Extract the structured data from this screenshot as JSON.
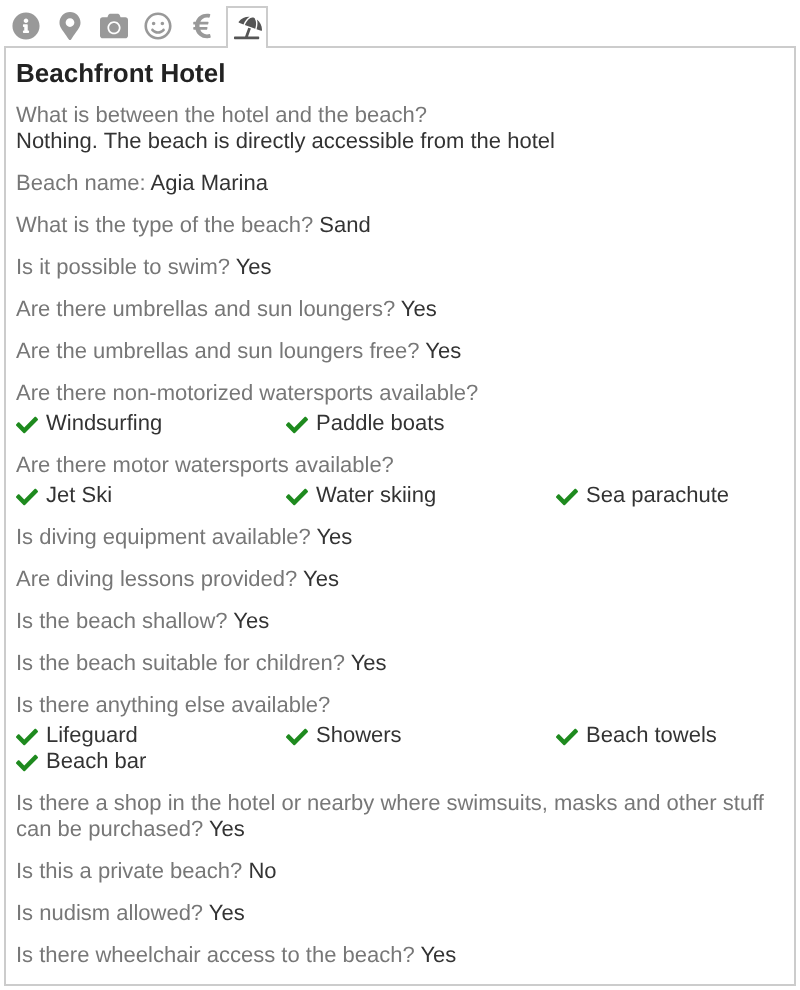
{
  "tabs": [
    {
      "selected": false
    },
    {
      "selected": false
    },
    {
      "selected": false
    },
    {
      "selected": false
    },
    {
      "selected": false
    },
    {
      "selected": true
    }
  ],
  "panel": {
    "title": "Beachfront Hotel",
    "items": [
      {
        "kind": "block",
        "question": "What is between the hotel and the beach?",
        "answer": "Nothing. The beach is directly accessible from the hotel"
      },
      {
        "kind": "inline",
        "question": "Beach name:",
        "answer": "Agia Marina"
      },
      {
        "kind": "inline",
        "question": "What is the type of the beach?",
        "answer": "Sand"
      },
      {
        "kind": "inline",
        "question": "Is it possible to swim?",
        "answer": "Yes"
      },
      {
        "kind": "inline",
        "question": "Are there umbrellas and sun loungers?",
        "answer": "Yes"
      },
      {
        "kind": "inline",
        "question": "Are the umbrellas and sun loungers free?",
        "answer": "Yes"
      },
      {
        "kind": "checklist",
        "question": "Are there non-motorized watersports available?",
        "options": [
          "Windsurfing",
          "Paddle boats"
        ]
      },
      {
        "kind": "checklist",
        "question": "Are there motor watersports available?",
        "options": [
          "Jet Ski",
          "Water skiing",
          "Sea parachute"
        ]
      },
      {
        "kind": "inline",
        "question": "Is diving equipment available?",
        "answer": "Yes"
      },
      {
        "kind": "inline",
        "question": "Are diving lessons provided?",
        "answer": "Yes"
      },
      {
        "kind": "inline",
        "question": "Is the beach shallow?",
        "answer": "Yes"
      },
      {
        "kind": "inline",
        "question": "Is the beach suitable for children?",
        "answer": "Yes"
      },
      {
        "kind": "checklist",
        "question": "Is there anything else available?",
        "options": [
          "Lifeguard",
          "Showers",
          "Beach towels",
          "Beach bar"
        ]
      },
      {
        "kind": "inline",
        "question": "Is there a shop in the hotel or nearby where swimsuits, masks and other stuff can be purchased?",
        "answer": "Yes"
      },
      {
        "kind": "inline",
        "question": "Is this a private beach?",
        "answer": "No"
      },
      {
        "kind": "inline",
        "question": "Is nudism allowed?",
        "answer": "Yes"
      },
      {
        "kind": "inline",
        "question": "Is there wheelchair access to the beach?",
        "answer": "Yes"
      }
    ]
  }
}
